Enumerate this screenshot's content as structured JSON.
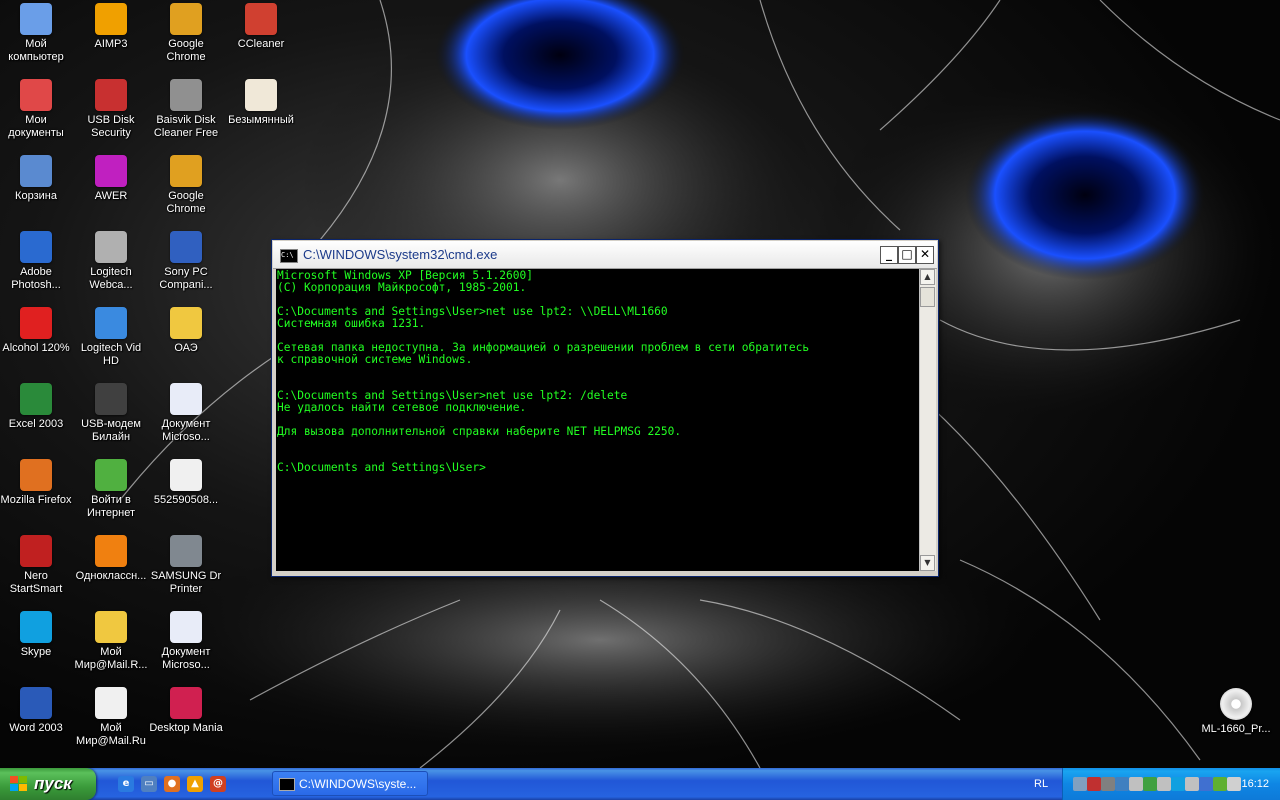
{
  "desktop": {
    "icons": [
      {
        "label": "Мой компьютер",
        "icon": "my-computer-icon",
        "color": "#6a9ee8"
      },
      {
        "label": "AIMP3",
        "icon": "aimp-icon",
        "color": "#f0a000"
      },
      {
        "label": "Google Chrome",
        "icon": "chrome-icon",
        "color": "#e0a020"
      },
      {
        "label": "CCleaner",
        "icon": "ccleaner-icon",
        "color": "#d04030"
      },
      {
        "label": "Мои документы",
        "icon": "my-documents-icon",
        "color": "#e04848"
      },
      {
        "label": "USB Disk Security",
        "icon": "usb-disk-security-icon",
        "color": "#c83030"
      },
      {
        "label": "Baisvik Disk Cleaner Free",
        "icon": "disk-cleaner-icon",
        "color": "#909090"
      },
      {
        "label": "Безымянный",
        "icon": "image-file-icon",
        "color": "#f0e8d8"
      },
      {
        "label": "Корзина",
        "icon": "recycle-bin-icon",
        "color": "#5a8ad0"
      },
      {
        "label": "AWER",
        "icon": "awer-icon",
        "color": "#c020c0"
      },
      {
        "label": "Google Chrome",
        "icon": "chrome-icon",
        "color": "#e0a020"
      },
      {
        "label": "Adobe Photosh...",
        "icon": "photoshop-icon",
        "color": "#2a6ad0"
      },
      {
        "label": "Logitech Webca...",
        "icon": "webcam-icon",
        "color": "#b0b0b0"
      },
      {
        "label": "Sony PC Compani...",
        "icon": "sony-pc-companion-icon",
        "color": "#3060c0"
      },
      {
        "label": "Alcohol 120%",
        "icon": "alcohol-icon",
        "color": "#e02020"
      },
      {
        "label": "Logitech Vid HD",
        "icon": "logitech-vid-icon",
        "color": "#3a8ae0"
      },
      {
        "label": "ОАЭ",
        "icon": "folder-icon",
        "color": "#f0c840"
      },
      {
        "label": "Excel 2003",
        "icon": "excel-icon",
        "color": "#2a8a3a"
      },
      {
        "label": "USB-модем Билайн",
        "icon": "usb-modem-icon",
        "color": "#404040"
      },
      {
        "label": "Документ Microso...",
        "icon": "word-document-icon",
        "color": "#e8ecf8"
      },
      {
        "label": "Mozilla Firefox",
        "icon": "firefox-icon",
        "color": "#e07020"
      },
      {
        "label": "Войти в Интернет",
        "icon": "internet-connect-icon",
        "color": "#50b040"
      },
      {
        "label": "552590508...",
        "icon": "firefox-document-icon",
        "color": "#f0f0f0"
      },
      {
        "label": "Nero StartSmart",
        "icon": "nero-icon",
        "color": "#c02020"
      },
      {
        "label": "Одноклассн...",
        "icon": "odnoklassniki-icon",
        "color": "#f08010"
      },
      {
        "label": "SAMSUNG Dr Printer",
        "icon": "samsung-printer-icon",
        "color": "#808890"
      },
      {
        "label": "Skype",
        "icon": "skype-icon",
        "color": "#10a0e0"
      },
      {
        "label": "Мой Мир@Mail.R...",
        "icon": "folder-icon",
        "color": "#f0c840"
      },
      {
        "label": "Документ Microso...",
        "icon": "word-document-icon",
        "color": "#e8ecf8"
      },
      {
        "label": "Word 2003",
        "icon": "word-icon",
        "color": "#2a5ab8"
      },
      {
        "label": "Мой Мир@Mail.Ru",
        "icon": "mail-ru-icon",
        "color": "#f0f0f0"
      },
      {
        "label": "Desktop Mania",
        "icon": "desktop-mania-icon",
        "color": "#d02050"
      }
    ],
    "right_icon": {
      "label": "ML-1660_Pr...",
      "icon": "cd-disc-icon"
    }
  },
  "cmd_window": {
    "title": "C:\\WINDOWS\\system32\\cmd.exe",
    "minimize": "_",
    "maximize": "□",
    "close": "✕",
    "lines": [
      "Microsoft Windows XP [Версия 5.1.2600]",
      "(С) Корпорация Майкрософт, 1985-2001.",
      "",
      "C:\\Documents and Settings\\User>net use lpt2: \\\\DELL\\ML1660",
      "Системная ошибка 1231.",
      "",
      "Сетевая папка недоступна. За информацией о разрешении проблем в сети обратитесь",
      "к справочной системе Windows.",
      "",
      "",
      "C:\\Documents and Settings\\User>net use lpt2: /delete",
      "Не удалось найти сетевое подключение.",
      "",
      "Для вызова дополнительной справки наберите NET HELPMSG 2250.",
      "",
      "",
      "C:\\Documents and Settings\\User>"
    ]
  },
  "taskbar": {
    "start_label": "пуск",
    "quick_launch": [
      {
        "icon": "internet-explorer-icon",
        "color": "#2a7ae0",
        "glyph": "e"
      },
      {
        "icon": "show-desktop-icon",
        "color": "#5080c0",
        "glyph": "▭"
      },
      {
        "icon": "firefox-icon",
        "color": "#e07020",
        "glyph": "●"
      },
      {
        "icon": "aimp-icon",
        "color": "#f0a000",
        "glyph": "▲"
      },
      {
        "icon": "mail-icon",
        "color": "#d04020",
        "glyph": "@"
      }
    ],
    "task_button": "C:\\WINDOWS\\syste...",
    "language": "RL",
    "clock": "16:12",
    "tray_icons": [
      {
        "icon": "network-icon",
        "color": "#80a0c0"
      },
      {
        "icon": "usb-security-tray-icon",
        "color": "#c03030"
      },
      {
        "icon": "modem-tray-icon",
        "color": "#808080"
      },
      {
        "icon": "device-tray-icon",
        "color": "#4080c0"
      },
      {
        "icon": "safely-remove-icon",
        "color": "#c0c0c0"
      },
      {
        "icon": "connection-tray-icon",
        "color": "#40a040"
      },
      {
        "icon": "volume-tray-icon",
        "color": "#c0c0c0"
      },
      {
        "icon": "skype-tray-icon",
        "color": "#10a0e0"
      },
      {
        "icon": "monitor-tray-icon",
        "color": "#c0c0c0"
      },
      {
        "icon": "webcam-tray-icon",
        "color": "#4070d0"
      },
      {
        "icon": "nvidia-tray-icon",
        "color": "#60b030"
      },
      {
        "icon": "disc-tray-icon",
        "color": "#d0d0d0"
      }
    ]
  }
}
